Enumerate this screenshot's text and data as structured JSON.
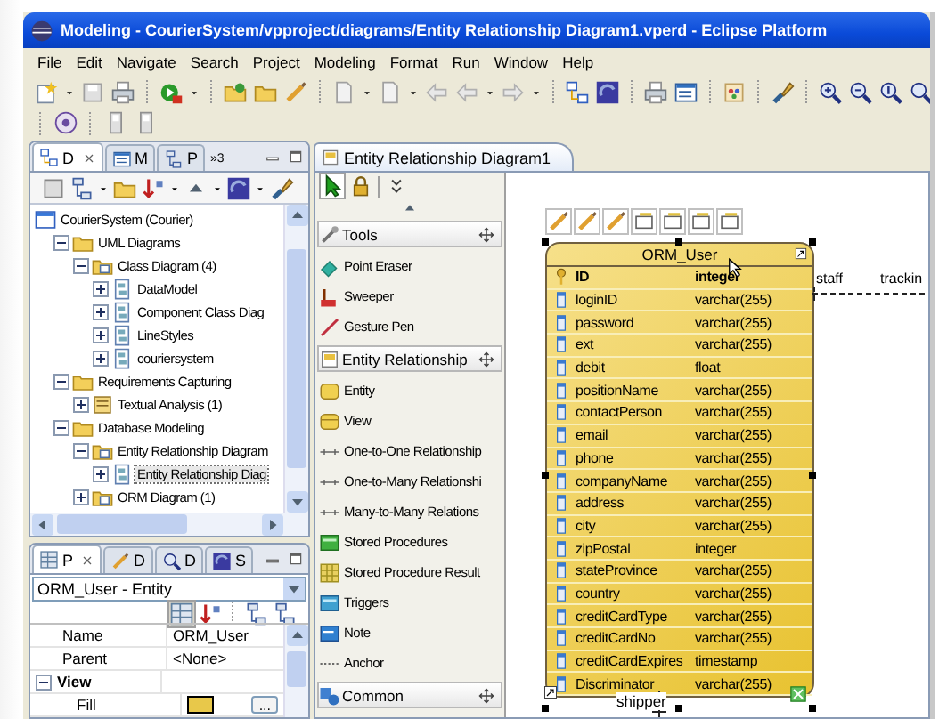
{
  "window": {
    "title": "Modeling - CourierSystem/vpproject/diagrams/Entity Relationship Diagram1.vperd - Eclipse Platform"
  },
  "menu": [
    "File",
    "Edit",
    "Navigate",
    "Search",
    "Project",
    "Modeling",
    "Format",
    "Run",
    "Window",
    "Help"
  ],
  "navigator": {
    "tabs": [
      {
        "label": "D",
        "selected": true
      },
      {
        "label": "M",
        "selected": false
      },
      {
        "label": "P",
        "selected": false
      }
    ],
    "overflow": "»3",
    "tree": [
      {
        "label": "CourierSystem (Courier)",
        "kind": "project",
        "selected": false,
        "children": [
          {
            "label": "UML Diagrams",
            "kind": "folder",
            "expanded": true,
            "selected": false,
            "children": [
              {
                "label": "Class Diagram (4)",
                "kind": "diagram-folder",
                "expanded": true,
                "selected": false,
                "children": [
                  {
                    "label": "DataModel",
                    "kind": "class-diagram",
                    "expanded": false,
                    "selected": false
                  },
                  {
                    "label": "Component Class Diag",
                    "kind": "class-diagram",
                    "expanded": false,
                    "selected": false
                  },
                  {
                    "label": "LineStyles",
                    "kind": "class-diagram",
                    "expanded": false,
                    "selected": false
                  },
                  {
                    "label": "couriersystem",
                    "kind": "class-diagram",
                    "expanded": false,
                    "selected": false
                  }
                ]
              }
            ]
          },
          {
            "label": "Requirements Capturing",
            "kind": "folder",
            "expanded": true,
            "selected": false,
            "children": [
              {
                "label": "Textual Analysis (1)",
                "kind": "textual",
                "expanded": false,
                "selected": false
              }
            ]
          },
          {
            "label": "Database Modeling",
            "kind": "folder",
            "expanded": true,
            "selected": false,
            "children": [
              {
                "label": "Entity Relationship Diagram",
                "kind": "diagram-folder",
                "expanded": true,
                "selected": false,
                "children": [
                  {
                    "label": "Entity Relationship Diag",
                    "kind": "class-diagram",
                    "expanded": false,
                    "selected": true
                  }
                ]
              },
              {
                "label": "ORM Diagram (1)",
                "kind": "diagram-folder",
                "expanded": false,
                "selected": false
              }
            ]
          }
        ]
      }
    ]
  },
  "properties": {
    "tabs": [
      {
        "label": "P",
        "selected": true
      },
      {
        "label": "D",
        "selected": false
      },
      {
        "label": "D",
        "selected": false
      },
      {
        "label": "S",
        "selected": false
      }
    ],
    "selector": "ORM_User - Entity",
    "rows": [
      {
        "kind": "text",
        "name": "Name",
        "value": "ORM_User"
      },
      {
        "kind": "text",
        "name": "Parent",
        "value": "<None>"
      },
      {
        "kind": "group",
        "name": "View",
        "expanded": true
      },
      {
        "kind": "swatch",
        "name": "Fill",
        "button": "..."
      }
    ]
  },
  "editor": {
    "tab": "Entity Relationship Diagram1",
    "palette": [
      {
        "label": "Tools",
        "kind": "tools",
        "items": [
          {
            "label": "Point Eraser",
            "kind": "eraser"
          },
          {
            "label": "Sweeper",
            "kind": "sweeper"
          },
          {
            "label": "Gesture Pen",
            "kind": "pen"
          }
        ]
      },
      {
        "label": "Entity Relationship",
        "kind": "er",
        "items": [
          {
            "label": "Entity",
            "kind": "entity"
          },
          {
            "label": "View",
            "kind": "view"
          },
          {
            "label": "One-to-One Relationship",
            "kind": "rel"
          },
          {
            "label": "One-to-Many Relationshi",
            "kind": "rel"
          },
          {
            "label": "Many-to-Many Relations",
            "kind": "rel"
          },
          {
            "label": "Stored Procedures",
            "kind": "proc"
          },
          {
            "label": "Stored Procedure Result",
            "kind": "result"
          },
          {
            "label": "Triggers",
            "kind": "trigger"
          },
          {
            "label": "Note",
            "kind": "note"
          },
          {
            "label": "Anchor",
            "kind": "anchor"
          }
        ]
      },
      {
        "label": "Common",
        "kind": "common"
      }
    ],
    "entity": {
      "name": "ORM_User",
      "columns": [
        {
          "name": "ID",
          "type": "integer",
          "kind": "key"
        },
        {
          "name": "loginID",
          "type": "varchar(255)",
          "kind": "column"
        },
        {
          "name": "password",
          "type": "varchar(255)",
          "kind": "column"
        },
        {
          "name": "ext",
          "type": "varchar(255)",
          "kind": "column"
        },
        {
          "name": "debit",
          "type": "float",
          "kind": "column"
        },
        {
          "name": "positionName",
          "type": "varchar(255)",
          "kind": "column"
        },
        {
          "name": "contactPerson",
          "type": "varchar(255)",
          "kind": "column"
        },
        {
          "name": "email",
          "type": "varchar(255)",
          "kind": "column"
        },
        {
          "name": "phone",
          "type": "varchar(255)",
          "kind": "column"
        },
        {
          "name": "companyName",
          "type": "varchar(255)",
          "kind": "column"
        },
        {
          "name": "address",
          "type": "varchar(255)",
          "kind": "column"
        },
        {
          "name": "city",
          "type": "varchar(255)",
          "kind": "column"
        },
        {
          "name": "zipPostal",
          "type": "integer",
          "kind": "column"
        },
        {
          "name": "stateProvince",
          "type": "varchar(255)",
          "kind": "column"
        },
        {
          "name": "country",
          "type": "varchar(255)",
          "kind": "column"
        },
        {
          "name": "creditCardType",
          "type": "varchar(255)",
          "kind": "column"
        },
        {
          "name": "creditCardNo",
          "type": "varchar(255)",
          "kind": "column"
        },
        {
          "name": "creditCardExpires",
          "type": "timestamp",
          "kind": "column"
        },
        {
          "name": "Discriminator",
          "type": "varchar(255)",
          "kind": "column"
        }
      ]
    },
    "connectors": [
      {
        "kind": "right",
        "labels": [
          "staff",
          "trackin"
        ]
      },
      {
        "kind": "bottom",
        "labels": [
          "shipper"
        ]
      }
    ]
  }
}
